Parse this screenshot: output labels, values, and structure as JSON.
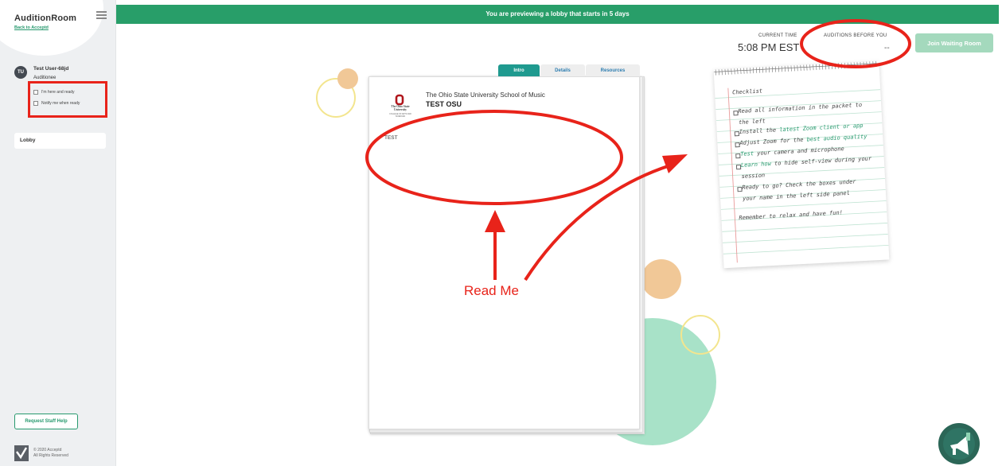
{
  "brand": {
    "name": "AuditionRoom",
    "back_link": "Back to Acceptd"
  },
  "user": {
    "initials": "TU",
    "name": "Test User-68jd",
    "role": "Auditionee"
  },
  "status_checks": [
    {
      "label": "I'm here and ready",
      "checked": false
    },
    {
      "label": "Notify me when ready",
      "checked": false
    }
  ],
  "nav": {
    "lobby": "Lobby"
  },
  "help_button": "Request Staff Help",
  "footer": {
    "line1": "© 2020 Acceptd",
    "line2": "All Rights Reserved"
  },
  "banner": "You are previewing a lobby that starts in 5 days",
  "header": {
    "time_label": "CURRENT TIME",
    "time_value": "5:08 PM EST",
    "auditions_label": "AUDITIONS BEFORE YOU",
    "auditions_value": "--",
    "join_button": "Join Waiting Room"
  },
  "tabs": [
    "Intro",
    "Details",
    "Resources"
  ],
  "document": {
    "logo_text": "The Ohio State University",
    "logo_subtext": "COLLEGE OF ARTS AND SCIENCES",
    "school": "The Ohio State University School of Music",
    "title": "TEST OSU",
    "body": "TEST"
  },
  "checklist": {
    "title": "Checklist",
    "items": [
      {
        "line1_plain": "Read all information in the packet to",
        "line2_plain": "the left"
      },
      {
        "pre": "Install the ",
        "link": "latest Zoom client or app",
        "post": ""
      },
      {
        "pre": "Adjust Zoom for the ",
        "link": "best audio quality",
        "post": ""
      },
      {
        "pre": "",
        "link": "Test",
        "post": " your camera and microphone"
      },
      {
        "pre": "",
        "link": "Learn how",
        "post": " to hide self-view during your",
        "line2_plain": "session"
      },
      {
        "line1_plain": "Ready to go? Check the boxes under",
        "line2_plain": "your name in the left side panel"
      }
    ],
    "footer": "Remember to relax and have fun!"
  },
  "annotation": {
    "text": "Read Me"
  },
  "colors": {
    "brand_green": "#289e69",
    "tab_teal": "#1f9a8f",
    "annotation_red": "#e8231a",
    "join_disabled": "#a4d9bd",
    "chat_bubble": "#2b6657"
  },
  "icons": {
    "menu": "hamburger-icon",
    "chat": "megaphone-icon",
    "logo": "acceptd-logo-icon"
  }
}
